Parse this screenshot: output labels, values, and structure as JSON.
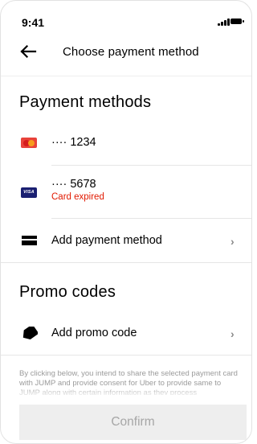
{
  "status_bar": {
    "time": "9:41"
  },
  "header": {
    "title": "Choose payment method"
  },
  "payment_methods": {
    "title": "Payment methods",
    "items": [
      {
        "icon": "mastercard-icon",
        "label": "···· 1234"
      },
      {
        "icon": "visa-icon",
        "label": "···· 5678",
        "sub": "Card expired",
        "visa_text": "VISA"
      }
    ],
    "add_label": "Add payment method"
  },
  "promo": {
    "title": "Promo codes",
    "add_label": "Add promo code"
  },
  "disclaimer": "By clicking below, you intend to share the selected payment card with JUMP and provide consent for Uber to provide same to JUMP along with certain information as they process",
  "confirm_label": "Confirm",
  "colors": {
    "error": "#e11900",
    "disabled_bg": "#eeeeee",
    "disabled_text": "#a6a6a6"
  }
}
